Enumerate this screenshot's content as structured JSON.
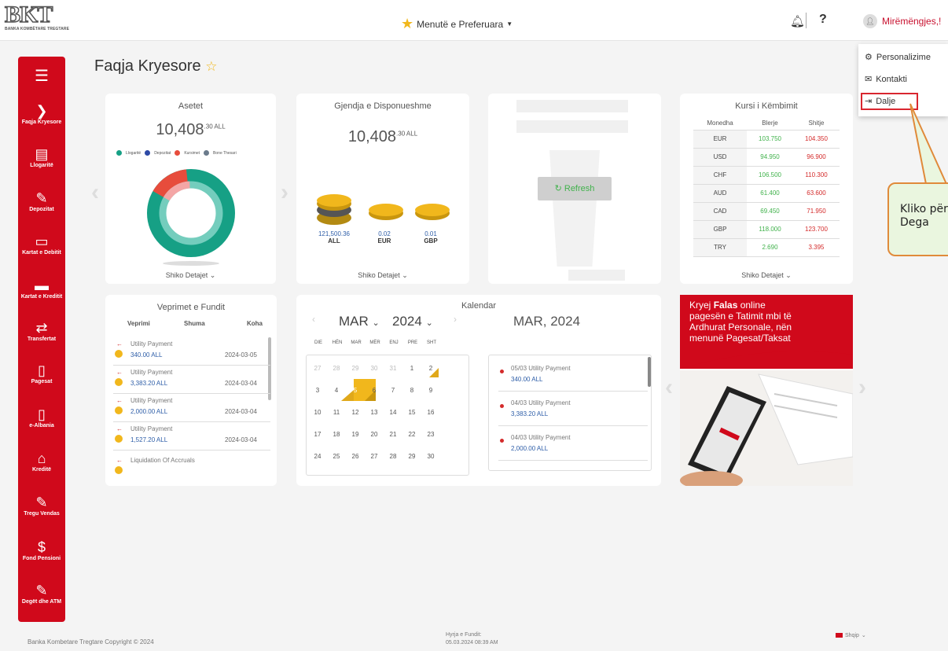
{
  "header": {
    "logo_text": "BKT",
    "logo_sub": "BANKA KOMBËTARE TREGTARE",
    "favorites_label": "Menutë e Preferuara",
    "help_label": "?",
    "greeting": "Mirëmëngjes,!",
    "user_menu": {
      "personalize": "Personalizime",
      "contact": "Kontakti",
      "logout": "Dalje"
    }
  },
  "tooltip": {
    "text": "Kliko për t Dega"
  },
  "sidebar": {
    "menu_icon": "hamburger-icon",
    "items": [
      {
        "label": "Faqja Kryesore",
        "icon": "home-icon"
      },
      {
        "label": "Llogaritë",
        "icon": "accounts-icon"
      },
      {
        "label": "Depozitat",
        "icon": "deposits-icon"
      },
      {
        "label": "Kartat e Debitit",
        "icon": "debit-card-icon"
      },
      {
        "label": "Kartat e Kreditit",
        "icon": "credit-card-icon"
      },
      {
        "label": "Transfertat",
        "icon": "transfer-icon"
      },
      {
        "label": "Pagesat",
        "icon": "payments-icon"
      },
      {
        "label": "e-Albania",
        "icon": "e-albania-icon"
      },
      {
        "label": "Kreditë",
        "icon": "loans-icon"
      },
      {
        "label": "Tregu Vendas",
        "icon": "market-icon"
      },
      {
        "label": "Fond Pensioni",
        "icon": "pension-icon"
      },
      {
        "label": "Degët dhe ATM",
        "icon": "branches-icon"
      }
    ]
  },
  "page": {
    "title": "Faqja Kryesore"
  },
  "assets": {
    "title": "Asetet",
    "total": "10,408",
    "total_sup": ".30 ALL",
    "legend": [
      "Llogaritë",
      "Depozitat",
      "Kursimet",
      "Bone Thesari"
    ],
    "legend_colors": [
      "#16a085",
      "#2e4aa6",
      "#e74c3c",
      "#6b7b8c"
    ],
    "details": "Shiko Detajet ⌄"
  },
  "balance": {
    "title": "Gjendja e Disponueshme",
    "total": "10,408",
    "total_sup": ".30 ALL",
    "coins": [
      {
        "amount": "121,500.36",
        "currency": "ALL"
      },
      {
        "amount": "0.02",
        "currency": "EUR"
      },
      {
        "amount": "0.01",
        "currency": "GBP"
      }
    ],
    "details": "Shiko Detajet ⌄"
  },
  "loading_card": {
    "refresh_label": "Refresh"
  },
  "exchange": {
    "title": "Kursi i Këmbimit",
    "headers": [
      "Monedha",
      "Blerje",
      "Shitje"
    ],
    "rows": [
      [
        "EUR",
        "103.750",
        "104.350"
      ],
      [
        "USD",
        "94.950",
        "96.900"
      ],
      [
        "CHF",
        "106.500",
        "110.300"
      ],
      [
        "AUD",
        "61.400",
        "63.600"
      ],
      [
        "CAD",
        "69.450",
        "71.950"
      ],
      [
        "GBP",
        "118.000",
        "123.700"
      ],
      [
        "TRY",
        "2.690",
        "3.395"
      ]
    ],
    "details": "Shiko Detajet ⌄"
  },
  "transactions": {
    "title": "Veprimet e Fundit",
    "headers": [
      "Veprimi",
      "Shuma",
      "Koha"
    ],
    "rows": [
      {
        "desc": "Utility Payment",
        "amount": "340.00 ALL",
        "date": "2024-03-05"
      },
      {
        "desc": "Utility Payment",
        "amount": "3,383.20 ALL",
        "date": "2024-03-04"
      },
      {
        "desc": "Utility Payment",
        "amount": "2,000.00 ALL",
        "date": "2024-03-04"
      },
      {
        "desc": "Utility Payment",
        "amount": "1,527.20 ALL",
        "date": "2024-03-04"
      },
      {
        "desc": "Liquidation Of Accruals",
        "amount": "",
        "date": ""
      }
    ]
  },
  "calendar": {
    "title": "Kalendar",
    "month": "MAR",
    "year": "2024",
    "heading": "MAR, 2024",
    "weekdays": [
      "DIE",
      "HËN",
      "MAR",
      "MËR",
      "ENJ",
      "PRE",
      "SHT"
    ],
    "weeks": [
      [
        "27",
        "28",
        "29",
        "30",
        "31",
        "1",
        "2"
      ],
      [
        "3",
        "4",
        "5",
        "6",
        "7",
        "8",
        "9"
      ],
      [
        "10",
        "11",
        "12",
        "13",
        "14",
        "15",
        "16"
      ],
      [
        "17",
        "18",
        "19",
        "20",
        "21",
        "22",
        "23"
      ],
      [
        "24",
        "25",
        "26",
        "27",
        "28",
        "29",
        "30"
      ]
    ],
    "events": [
      {
        "label": "05/03 Utility Payment",
        "amount": "340.00 ALL"
      },
      {
        "label": "04/03 Utility Payment",
        "amount": "3,383.20 ALL"
      },
      {
        "label": "04/03 Utility Payment",
        "amount": "2,000.00 ALL"
      }
    ]
  },
  "promo": {
    "line1a": "Kryej ",
    "line1b": "Falas",
    "line1c": " online",
    "line2": "pagesën e Tatimit mbi të",
    "line3": "Ardhurat Personale, nën",
    "line4": "menunë Pagesat/Taksat"
  },
  "footer": {
    "copyright": "Banka Kombetare Tregtare Copyright © 2024",
    "last_login_label": "Hyrja e Fundit:",
    "last_login_value": "05.03.2024 08:39 AM",
    "language": "Shqip"
  },
  "colors": {
    "brand_red": "#d0091b",
    "accent_green": "#41b24c",
    "gold": "#f1b71c"
  }
}
